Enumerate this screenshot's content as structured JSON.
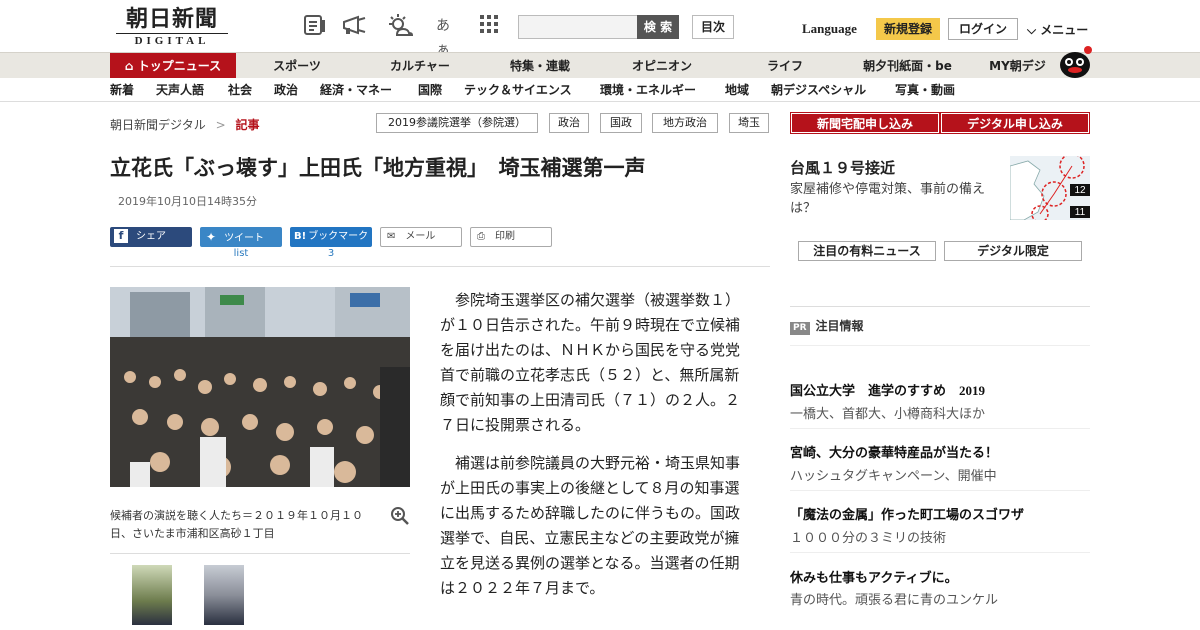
{
  "header": {
    "logo_jp": "朝日新聞",
    "logo_en": "DIGITAL",
    "icons": [
      "newspaper-icon",
      "megaphone-icon",
      "weather-icon",
      "font-size-icon",
      "grid-icon"
    ],
    "font_label": "あぁ",
    "search_button": "検 索",
    "toc_button": "目次",
    "language": "Language",
    "register": "新規登録",
    "login": "ログイン",
    "menu": "メニュー"
  },
  "nav_primary": [
    "トップニュース",
    "スポーツ",
    "カルチャー",
    "特集・連載",
    "オピニオン",
    "ライフ",
    "朝夕刊紙面・be",
    "MY朝デジ"
  ],
  "nav_secondary": [
    "新着",
    "天声人語",
    "社会",
    "政治",
    "経済・マネー",
    "国際",
    "テック＆サイエンス",
    "環境・エネルギー",
    "地域",
    "朝デジスペシャル",
    "写真・動画"
  ],
  "breadcrumb": {
    "home": "朝日新聞デジタル",
    "sep": ">",
    "current": "記事"
  },
  "tags": [
    "2019参議院選挙（参院選）",
    "政治",
    "国政",
    "地方政治",
    "埼玉"
  ],
  "article": {
    "title": "立花氏「ぶっ壊す」上田氏「地方重視」　埼玉補選第一声",
    "date": "2019年10月10日14時35分",
    "share": {
      "facebook": "シェア",
      "twitter": "ツイート",
      "twitter_count": "list",
      "hatena": "ブックマーク",
      "hatena_count": "3",
      "mail": "メール",
      "print": "印刷"
    },
    "caption": "候補者の演説を聴く人たち＝２０１９年１０月１０日、さいたま市浦和区高砂１丁目",
    "paragraphs": [
      "参院埼玉選挙区の補欠選挙（被選挙数１）が１０日告示された。午前９時現在で立候補を届け出たのは、ＮＨＫから国民を守る党党首で前職の立花孝志氏（５２）と、無所属新顔で前知事の上田清司氏（７１）の２人。２７日に投開票される。",
      "補選は前参院議員の大野元裕・埼玉県知事が上田氏の事実上の後継として８月の知事選に出馬するため辞職したのに伴うもの。国政選挙で、自民、立憲民主などの主要政党が擁立を見送る異例の選挙となる。当選者の任期は２０２２年７月まで。"
    ]
  },
  "sidebar": {
    "subscribe_paper": "新聞宅配申し込み",
    "subscribe_digital": "デジタル申し込み",
    "typhoon_title": "台風１９号接近",
    "typhoon_sub": "家屋補修や停電対策、事前の備えは？",
    "map_labels": [
      "12",
      "11"
    ],
    "paid_news": "注目の有料ニュース",
    "digital_only": "デジタル限定",
    "pr_badge": "PR",
    "pr_title": "注目情報",
    "pr_items": [
      {
        "title": "国公立大学　進学のすすめ　2019",
        "sub": "一橋大、首都大、小樽商科大ほか"
      },
      {
        "title": "宮崎、大分の豪華特産品が当たる！",
        "sub": "ハッシュタグキャンペーン、開催中"
      },
      {
        "title": "「魔法の金属」作った町工場のスゴワザ",
        "sub": "１０００分の３ミリの技術"
      },
      {
        "title": "休みも仕事もアクティブに。",
        "sub": "青の時代。頑張る君に青のユンケル"
      }
    ]
  },
  "colors": {
    "brand_red": "#b5121b",
    "register_yellow": "#f4c84a",
    "facebook": "#2c4a7c",
    "twitter": "#3a86c6",
    "hatena": "#2275c2"
  }
}
